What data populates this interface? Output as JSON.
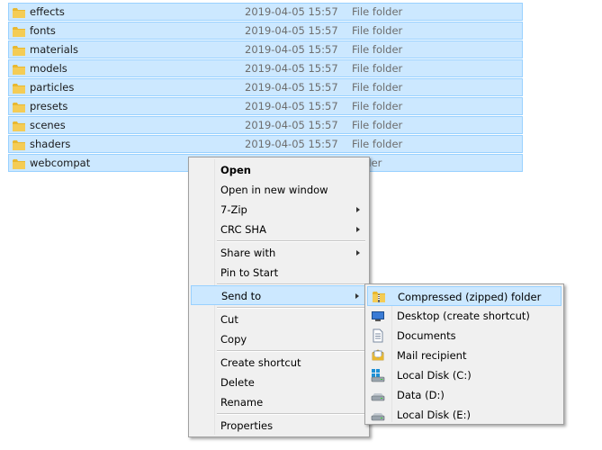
{
  "files": [
    {
      "name": "effects",
      "date": "2019-04-05 15:57",
      "type": "File folder"
    },
    {
      "name": "fonts",
      "date": "2019-04-05 15:57",
      "type": "File folder"
    },
    {
      "name": "materials",
      "date": "2019-04-05 15:57",
      "type": "File folder"
    },
    {
      "name": "models",
      "date": "2019-04-05 15:57",
      "type": "File folder"
    },
    {
      "name": "particles",
      "date": "2019-04-05 15:57",
      "type": "File folder"
    },
    {
      "name": "presets",
      "date": "2019-04-05 15:57",
      "type": "File folder"
    },
    {
      "name": "scenes",
      "date": "2019-04-05 15:57",
      "type": "File folder"
    },
    {
      "name": "shaders",
      "date": "2019-04-05 15:57",
      "type": "File folder"
    },
    {
      "name": "webcompat",
      "date": "",
      "type": "folder"
    }
  ],
  "context_menu": {
    "open": "Open",
    "open_new_window": "Open in new window",
    "seven_zip": "7-Zip",
    "crc_sha": "CRC SHA",
    "share_with": "Share with",
    "pin_to_start": "Pin to Start",
    "send_to": "Send to",
    "cut": "Cut",
    "copy": "Copy",
    "create_shortcut": "Create shortcut",
    "delete": "Delete",
    "rename": "Rename",
    "properties": "Properties"
  },
  "send_to_menu": {
    "compressed": "Compressed (zipped) folder",
    "desktop": "Desktop (create shortcut)",
    "documents": "Documents",
    "mail": "Mail recipient",
    "local_c": "Local Disk (C:)",
    "data_d": "Data (D:)",
    "local_e": "Local Disk (E:)"
  },
  "colors": {
    "selection": "#cce8ff",
    "selection_border": "#99d1ff",
    "menu_bg": "#f0f0f0",
    "folder_yellow": "#e8b830"
  }
}
